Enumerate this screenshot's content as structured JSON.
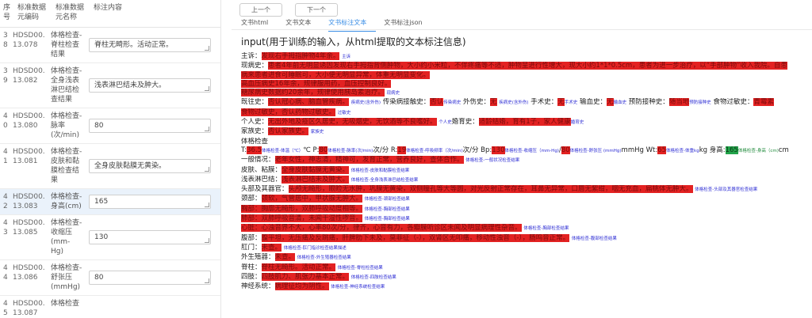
{
  "table": {
    "headers": [
      "序号",
      "标准数据元编码",
      "标准数据元名称",
      "标注内容"
    ],
    "rows": [
      {
        "seq": "38",
        "code": "HDSD00.13.078",
        "name": "体格检查-脊柱检查结果",
        "value": "脊柱无畸形。活动正常。",
        "selected": false
      },
      {
        "seq": "39",
        "code": "HDSD00.13.082",
        "name": "体格检查-全身浅表淋巴结检查结果",
        "value": "浅表淋巴结未及肿大。",
        "selected": false
      },
      {
        "seq": "40",
        "code": "HDSD00.13.080",
        "name": "体格检查-脉率(次/min)",
        "value": "80",
        "selected": false
      },
      {
        "seq": "41",
        "code": "HDSD00.13.081",
        "name": "体格检查-皮肤和黏膜检查结果",
        "value": "全身皮肤黏膜无黄染。",
        "selected": false
      },
      {
        "seq": "42",
        "code": "HDSD00.13.083",
        "name": "体格检查-身高(cm)",
        "value": "165",
        "selected": true
      },
      {
        "seq": "43",
        "code": "HDSD00.13.085",
        "name": "体格检查-收缩压(mm-Hg)",
        "value": "130",
        "selected": false
      },
      {
        "seq": "44",
        "code": "HDSD00.13.086",
        "name": "体格检查-舒张压(mmHg)",
        "value": "80",
        "selected": false
      },
      {
        "seq": "45",
        "code": "HDSD00.13.087",
        "name": "体格检查",
        "value": "",
        "selected": false
      }
    ]
  },
  "buttons": {
    "prev": "上一个",
    "next": "下一个"
  },
  "tabs": [
    {
      "label": "文书html",
      "active": false
    },
    {
      "label": "文书文本",
      "active": false
    },
    {
      "label": "文书标注文本",
      "active": true
    },
    {
      "label": "文书标注json",
      "active": false
    }
  ],
  "heading": "input(用于训练的输入，从html提取的文本标注信息)",
  "doc": {
    "l1_label": "主诉：",
    "l1_hl": "发现右手拇指肿物4年余。",
    "l1_tag": "主诉",
    "l2_label": "现病史：",
    "l2_hl": "患者4年前无明显诱因发现右手拇指背侧肿物，大小约小米粒，不伴疼痛等不适，肿物呈进行性增大，现大小约1*1*0.5cm，患者为进一步治疗，以“手部肿物”收入我院。自患",
    "l3_hl": "病来患者进食可睡眠可，大小便无明显异常，体重无明显变化。",
    "l4_hl": "高血压病史16年余，规律服用药，血压控制良好。",
    "l5_hl": "糖尿病史数据约20余年，规律使用胰岛素治疗。",
    "l5_tag": "现病史",
    "l6_label": "既往史：",
    "l6_hl1": "否认冠心病、脑血管疾病。",
    "l6_tag1": "疾病史(含外伤)",
    "l6_mid1": "传染病接触史：",
    "l6_hl2": "否认",
    "l6_tag2": "传染病史",
    "l6_mid2": "外伤史：",
    "l6_hl3": "无",
    "l6_tag3": "疾病史(含外伤)",
    "l6_mid3": "手术史：",
    "l6_hl4": "无",
    "l6_tag4": "手术史",
    "l6_mid4": "输血史：",
    "l6_hl5": "无",
    "l6_tag5": "输血史",
    "l6_mid5": "预防接种史：",
    "l6_hl6": "随当地",
    "l6_tag6": "预防接种史",
    "l6_mid6": "食物过敏史：",
    "l6_hl7": "青霉素",
    "l7_hl": "食物过敏史，否认药物过敏史。",
    "l7_tag": "过敏史",
    "l8_label": "个人史：",
    "l8_hl1": "无出外地及疫区久居史，无吸烟史，无饮酒等不良嗜好。",
    "l8_tag1": "个人史",
    "l8_mid": "婚育史：",
    "l8_hl2": "适龄结婚，育有1子，家人健康",
    "l8_tag2": "婚育史",
    "l9_label": "家族史：",
    "l9_hl": "否认家族史。",
    "l9_tag": "家族史",
    "l10_label": "体格检查",
    "l11_pre": "T:",
    "l11_hl1": "36.5",
    "l11_tag1": "体格检查-体温（℃）",
    "l11_u1": "℃ P:",
    "l11_hl2": "80",
    "l11_tag2": "体格检查-脉率(次/min)",
    "l11_u2": "次/分 R:",
    "l11_hl3": "19",
    "l11_tag3": "体格检查-呼吸频率（次/min)",
    "l11_u3": "次/分 Bp:",
    "l11_hl4": "130",
    "l11_tag4": "体格检查-收缩压（mm-Hg)",
    "l11_hl5": "80",
    "l11_tag5": "体格检查-舒张压 (mmHg)",
    "l11_u5": "mmHg Wt:",
    "l11_hl6": "65",
    "l11_tag6": "体格检查-体重kg",
    "l11_u6": "kg 身高:",
    "l11_hg": "165",
    "l11_tag7": "体格检查-身高（cm)",
    "l11_u7": "cm",
    "l12_label": "一般情况：",
    "l12_hl": "老年女性，神志清，精神可，发育正常，营养良好，查体合作。",
    "l12_tag": "体格检查-一般状况检查结果",
    "l13_label": "皮肤、粘膜：",
    "l13_hl": "全身皮肤黏膜无黄染。",
    "l13_tag": "体格检查-皮肤和黏膜检查结果",
    "l14_label": "浅表淋巴结：",
    "l14_hl": "浅表淋巴结未及肿大。",
    "l14_tag": "体格检查-全身浅表淋巴结检查结果",
    "l15_label": "头部及其器官：",
    "l15_hl": "头颅无畸形，眼睑无水肿，巩膜无黄染，双侧瞳孔等大等圆，对光反射正常存在，耳鼻无异常，口唇无紫绀，咽无充血，扁桃体无肿大。",
    "l15_tag": "体格检查-头部及其器官检查结果",
    "l16_label": "颈部：",
    "l16_hl": "颈软，气管居中，甲状腺无肿大。",
    "l16_tag": "体格检查-颈部检查结果",
    "l17_hl": "胸部：胸廓无畸形，双肺呼吸动度相等。",
    "l17_tag": "体格检查-胸部检查结果",
    "l18_hl": "肺部：双肺呼吸音清，未闻干湿性啰音。",
    "l18_tag": "体格检查-胸部检查结果",
    "l19_hl": "心脏：心浊音界不大，心率80次/分，律齐，心音有力，各瓣膜听诊区未闻及明显病理性杂音。",
    "l19_tag": "体格检查-胸部检查结果",
    "l20_label": "腹部：",
    "l20_hl": "腹平坦，无压痛及反跳痛，肝脾肋下未及，莫菲征（-），双肾区无叩痛，移动性浊音（-），肠鸣音正常。",
    "l20_tag": "体格检查-腹部检查结果",
    "l21_label": "肛门：",
    "l21_hl": "未查。",
    "l21_tag": "体格检查-肛门指诊检查结果描述",
    "l22_label": "外生殖器：",
    "l22_hl": "未查。",
    "l22_tag": "体格检查-外生殖器检查结果",
    "l23_label": "脊柱：",
    "l23_hl": "脊柱无畸形。活动正常。",
    "l23_tag": "体格检查-脊柱检查结果",
    "l24_label": "四肢：",
    "l24_hl": "四肢肌力、肌张力基本正常。",
    "l24_tag": "体格检查-四肢检查结果",
    "l25_label": "神经系统：",
    "l25_hl": "病理征均为阴性。",
    "l25_tag": "体格检查-神经系统检查结果"
  },
  "colors": {
    "highlight": "#e32222",
    "highlight_green": "#22a34a",
    "tag_blue": "#2d2dd4",
    "tab_active": "#3a8ee6",
    "row_selected": "#eaf2fb"
  }
}
